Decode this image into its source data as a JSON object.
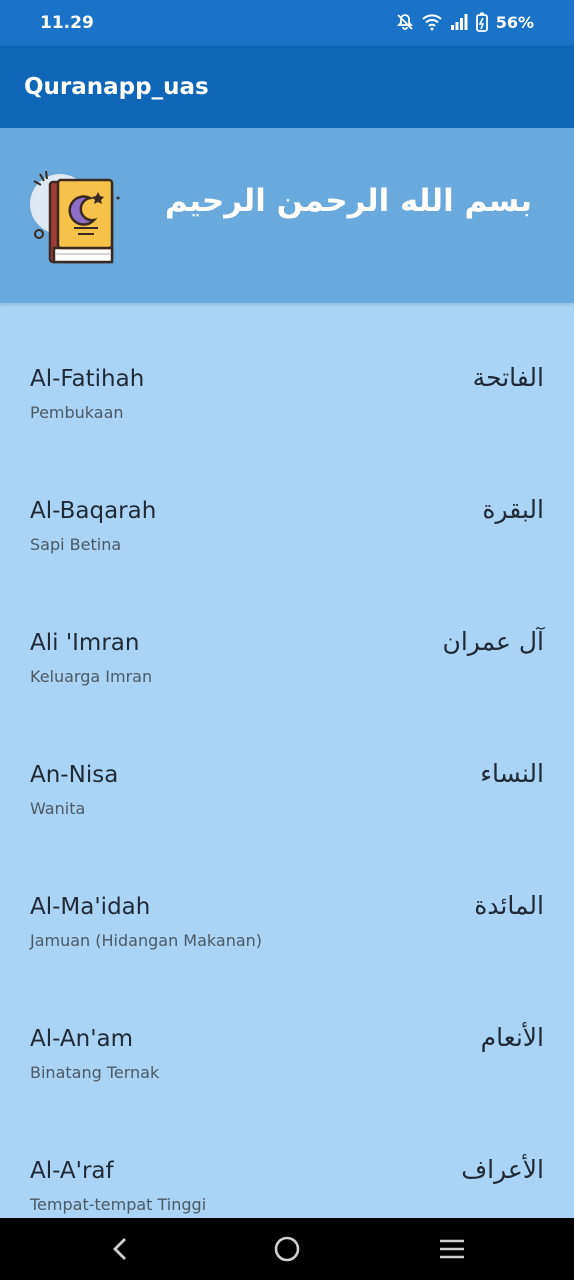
{
  "status_bar": {
    "time": "11.29",
    "battery": "56%",
    "icons": [
      "mute-icon",
      "wifi-icon",
      "signal-icon",
      "battery-icon"
    ]
  },
  "app_bar": {
    "title": "Quranapp_uas",
    "color": "#0f66b6"
  },
  "banner": {
    "basmala": "بسم الله الرحمن الرحيم",
    "icon": "quran-book-icon",
    "color": "#6aa9dc"
  },
  "surahs": [
    {
      "latin": "Al-Fatihah",
      "meaning": "Pembukaan",
      "arabic": "الفاتحة"
    },
    {
      "latin": "Al-Baqarah",
      "meaning": "Sapi Betina",
      "arabic": "البقرة"
    },
    {
      "latin": "Ali 'Imran",
      "meaning": "Keluarga Imran",
      "arabic": "آل عمران"
    },
    {
      "latin": "An-Nisa",
      "meaning": "Wanita",
      "arabic": "النساء"
    },
    {
      "latin": "Al-Ma'idah",
      "meaning": "Jamuan (Hidangan Makanan)",
      "arabic": "المائدة"
    },
    {
      "latin": "Al-An'am",
      "meaning": "Binatang Ternak",
      "arabic": "الأنعام"
    },
    {
      "latin": "Al-A'raf",
      "meaning": "Tempat-tempat Tinggi",
      "arabic": "الأعراف"
    }
  ],
  "nav_bar": {
    "icons": [
      "back-icon",
      "home-icon",
      "recents-icon"
    ]
  },
  "colors": {
    "list_background": "#a9d4f5",
    "status_bar": "#1a73c7"
  }
}
